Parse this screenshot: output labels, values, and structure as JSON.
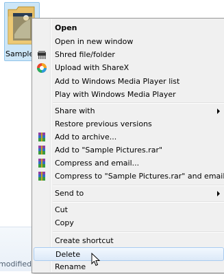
{
  "explorer": {
    "folder_label": "Sample Pictures",
    "details_label": "modified:"
  },
  "menu": {
    "items": [
      {
        "label": "Open",
        "bold": true
      },
      {
        "label": "Open in new window"
      },
      {
        "label": "Shred file/folder",
        "icon": "shredder-icon"
      },
      {
        "label": "Upload with ShareX",
        "icon": "sharex-icon"
      },
      {
        "label": "Add to Windows Media Player list"
      },
      {
        "label": "Play with Windows Media Player"
      },
      {
        "label": "Share with",
        "submenu": true
      },
      {
        "label": "Restore previous versions"
      },
      {
        "label": "Add to archive...",
        "icon": "winrar-icon"
      },
      {
        "label": "Add to \"Sample Pictures.rar\"",
        "icon": "winrar-icon"
      },
      {
        "label": "Compress and email...",
        "icon": "winrar-icon"
      },
      {
        "label": "Compress to \"Sample Pictures.rar\" and email",
        "icon": "winrar-icon"
      },
      {
        "label": "Send to",
        "submenu": true
      },
      {
        "label": "Cut"
      },
      {
        "label": "Copy"
      },
      {
        "label": "Create shortcut"
      },
      {
        "label": "Delete",
        "highlighted": true
      },
      {
        "label": "Rename"
      }
    ]
  },
  "colors": {
    "highlight_border": "#a9cbf0",
    "menu_background": "#f0f0f0",
    "folder_selection": "#cde6f7"
  }
}
